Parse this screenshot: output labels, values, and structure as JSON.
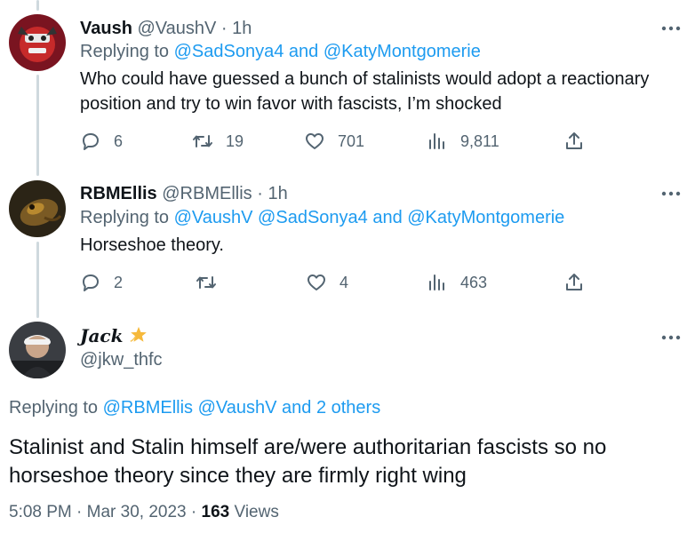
{
  "tweets": [
    {
      "name": "Vaush",
      "handle": "@VaushV",
      "separator": "·",
      "time": "1h",
      "replying_prefix": "Replying to",
      "replying_mentions": "@SadSonya4 and @KatyMontgomerie",
      "text_line1": "Who could have guessed a bunch of stalinists would adopt a reactionary",
      "text_line2": "position and try to win favor with fascists, I’m shocked",
      "replies": "6",
      "retweets": "19",
      "likes": "701",
      "views": "9,811"
    },
    {
      "name": "RBMEllis",
      "handle": "@RBMEllis",
      "separator": "·",
      "time": "1h",
      "replying_prefix": "Replying to",
      "replying_mentions": "@VaushV @SadSonya4 and @KatyMontgomerie",
      "text": "Horseshoe theory.",
      "replies": "2",
      "retweets": "",
      "likes": "4",
      "views": "463"
    }
  ],
  "main": {
    "name": "Jack",
    "handle": "@jkw_thfc",
    "replying_prefix": "Replying to",
    "replying_mentions": "@RBMEllis @VaushV and 2 others",
    "text_line1": "Stalinist and Stalin himself are/were authoritarian fascists so no",
    "text_line2": "horseshoe theory since they are firmly right wing",
    "time": "5:08 PM",
    "date": "Mar 30, 2023",
    "separator": "·",
    "views_count": "163",
    "views_label": "Views"
  },
  "icons": {
    "reply": "reply-icon",
    "retweet": "retweet-icon",
    "like": "heart-icon",
    "views": "views-chart-icon",
    "share": "share-icon",
    "more": "more-dots-icon"
  },
  "colors": {
    "link": "#1d9bf0",
    "secondary": "#536471",
    "text": "#0f1419",
    "thread_line": "#cfd9de"
  }
}
